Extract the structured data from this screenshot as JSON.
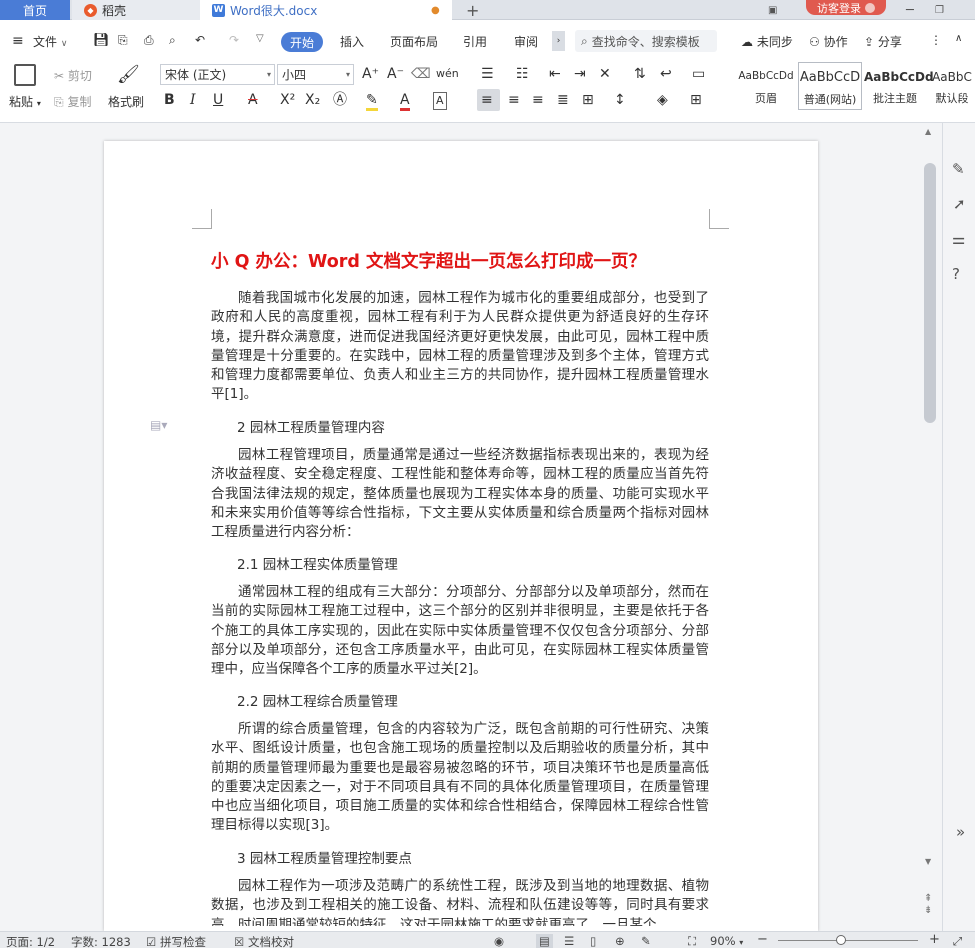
{
  "tabs": {
    "home": "首页",
    "daoke": "稻壳",
    "doc": "Word很大.docx",
    "new_tab": "+",
    "login": "访客登录"
  },
  "menu": {
    "file": "文件",
    "start": "开始",
    "insert": "插入",
    "layout": "页面布局",
    "reference": "引用",
    "review": "审阅",
    "search": "查找命令、搜索模板",
    "sync": "未同步",
    "collab": "协作",
    "share": "分享"
  },
  "ribbon": {
    "paste": "粘贴",
    "cut": "剪切",
    "copy": "复制",
    "format_painter": "格式刷",
    "font_name": "宋体 (正文)",
    "font_size": "小四",
    "styles": [
      {
        "sample": "AaBbCcDd",
        "label": "页眉"
      },
      {
        "sample": "AaBbCcD",
        "label": "普通(网站)"
      },
      {
        "sample": "AaBbCcDd",
        "label": "批注主题"
      },
      {
        "sample": "AaBbC",
        "label": "默认段"
      }
    ]
  },
  "document": {
    "title": "小 Q 办公：Word 文档文字超出一页怎么打印成一页？",
    "blocks": [
      {
        "type": "para",
        "text": "随着我国城市化发展的加速，园林工程作为城市化的重要组成部分，也受到了政府和人民的高度重视，园林工程有利于为人民群众提供更为舒适良好的生存环境，提升群众满意度，进而促进我国经济更好更快发展，由此可见，园林工程中质量管理是十分重要的。在实践中，园林工程的质量管理涉及到多个主体，管理方式和管理力度都需要单位、负责人和业主三方的共同协作，提升园林工程质量管理水平[1]。"
      },
      {
        "type": "head",
        "text": "2 园林工程质量管理内容"
      },
      {
        "type": "para",
        "text": "园林工程管理项目，质量通常是通过一些经济数据指标表现出来的，表现为经济收益程度、安全稳定程度、工程性能和整体寿命等，园林工程的质量应当首先符合我国法律法规的规定，整体质量也展现为工程实体本身的质量、功能可实现水平和未来实用价值等等综合性指标，下文主要从实体质量和综合质量两个指标对园林工程质量进行内容分析："
      },
      {
        "type": "head",
        "text": "2.1 园林工程实体质量管理"
      },
      {
        "type": "para",
        "text": "通常园林工程的组成有三大部分：分项部分、分部部分以及单项部分，然而在当前的实际园林工程施工过程中，这三个部分的区别并非很明显，主要是依托于各个施工的具体工序实现的，因此在实际中实体质量管理不仅仅包含分项部分、分部部分以及单项部分，还包含工序质量水平，由此可见，在实际园林工程实体质量管理中，应当保障各个工序的质量水平过关[2]。"
      },
      {
        "type": "head",
        "text": "2.2 园林工程综合质量管理"
      },
      {
        "type": "para",
        "text": "所谓的综合质量管理，包含的内容较为广泛，既包含前期的可行性研究、决策水平、图纸设计质量，也包含施工现场的质量控制以及后期验收的质量分析，其中前期的质量管理师最为重要也是最容易被忽略的环节，项目决策环节也是质量高低的重要决定因素之一，对于不同项目具有不同的具体化质量管理项目，在质量管理中也应当细化项目，项目施工质量的实体和综合性相结合，保障园林工程综合性管理目标得以实现[3]。"
      },
      {
        "type": "head",
        "text": "3 园林工程质量管理控制要点"
      },
      {
        "type": "para",
        "text": "园林工程作为一项涉及范畴广的系统性工程，既涉及到当地的地理数据、植物数据，也涉及到工程相关的施工设备、材料、流程和队伍建设等等，同时具有要求高、时间周期通常较短的特征，这对于园林施工的要求就更高了，一旦某个"
      }
    ]
  },
  "status": {
    "page": "页面: 1/2",
    "words": "字数: 1283",
    "spell": "拼写检查",
    "proof": "文档校对",
    "zoom": "90%",
    "zoom_fraction": 0.45
  }
}
